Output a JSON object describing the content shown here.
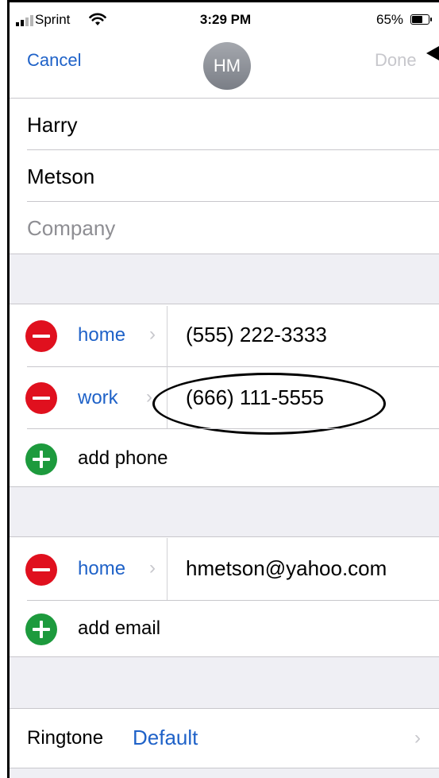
{
  "status_bar": {
    "carrier": "Sprint",
    "time": "3:29 PM",
    "battery_percent": "65%",
    "battery_level": 0.65
  },
  "nav": {
    "cancel_label": "Cancel",
    "avatar_initials": "HM",
    "done_label": "Done"
  },
  "name": {
    "first": "Harry",
    "last": "Metson",
    "company_placeholder": "Company"
  },
  "phones": [
    {
      "label": "home",
      "value": "(555) 222-3333"
    },
    {
      "label": "work",
      "value": "(666) 111-5555"
    }
  ],
  "add_phone_label": "add phone",
  "emails": [
    {
      "label": "home",
      "value": "hmetson@yahoo.com"
    }
  ],
  "add_email_label": "add email",
  "ringtone": {
    "label": "Ringtone",
    "value": "Default"
  },
  "icons": [
    "wifi-icon",
    "battery-icon",
    "signal-icon",
    "delete-icon",
    "add-icon",
    "chevron-right-icon"
  ],
  "colors": {
    "accent": "#1f62c8",
    "delete": "#e0101e",
    "add": "#1d9a3d",
    "disabled": "#c7c7cc",
    "group_bg": "#efeff4"
  }
}
